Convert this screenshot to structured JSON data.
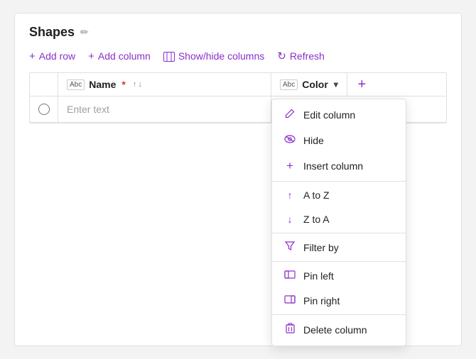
{
  "title": "Shapes",
  "toolbar": {
    "add_row": "Add row",
    "add_column": "Add column",
    "show_hide_columns": "Show/hide columns",
    "refresh": "Refresh"
  },
  "table": {
    "name_col": "Name",
    "required_marker": "*",
    "color_col": "Color",
    "add_btn": "+",
    "placeholder": "Enter text"
  },
  "dropdown": {
    "items": [
      {
        "id": "edit-column",
        "icon": "pencil",
        "label": "Edit column"
      },
      {
        "id": "hide",
        "icon": "hide",
        "label": "Hide"
      },
      {
        "id": "insert-column",
        "icon": "plus",
        "label": "Insert column"
      },
      {
        "id": "a-to-z",
        "icon": "arrow-up",
        "label": "A to Z"
      },
      {
        "id": "z-to-a",
        "icon": "arrow-down",
        "label": "Z to A"
      },
      {
        "id": "filter-by",
        "icon": "filter",
        "label": "Filter by"
      },
      {
        "id": "pin-left",
        "icon": "pin-left",
        "label": "Pin left"
      },
      {
        "id": "pin-right",
        "icon": "pin-right",
        "label": "Pin right"
      },
      {
        "id": "delete-column",
        "icon": "delete",
        "label": "Delete column"
      }
    ]
  }
}
